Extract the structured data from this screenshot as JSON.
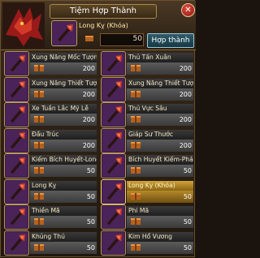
{
  "header": {
    "title": "Tiệm Hợp Thành",
    "close_symbol": "✕",
    "target_name": "Long Kỵ (Khóa)",
    "target_qty": "50",
    "craft_label": "Hợp thành",
    "target_icon": "purple-axe-icon"
  },
  "items": [
    {
      "name": "Xung Năng Mốc Tượng",
      "qty": "200"
    },
    {
      "name": "Thủ Tấn Xuân",
      "qty": "200"
    },
    {
      "name": "Xung Năng Thiết Tượng",
      "qty": "200"
    },
    {
      "name": "Xung Năng Thiết Tượng",
      "qty": "200"
    },
    {
      "name": "Xe Tuần Lắc Mỹ Lễ",
      "qty": "200"
    },
    {
      "name": "Thủ Vực Sâu",
      "qty": "200"
    },
    {
      "name": "Đầu Trúc",
      "qty": "200"
    },
    {
      "name": "Giáp Sư Thước",
      "qty": "200"
    },
    {
      "name": "Kiếm Bích Huyết-Long",
      "qty": "50"
    },
    {
      "name": "Bích Huyết Kiếm-Phá Vu",
      "qty": "50"
    },
    {
      "name": "Long Kỵ",
      "qty": "50"
    },
    {
      "name": "Long Kỵ (Khóa)",
      "qty": "50",
      "selected": true
    },
    {
      "name": "Thiền Mã",
      "qty": "50"
    },
    {
      "name": "Phi Mã",
      "qty": "50"
    },
    {
      "name": "Khủng Thú",
      "qty": "50"
    },
    {
      "name": "Kim Hổ Vương",
      "qty": "50"
    }
  ],
  "colors": {
    "accent_gold": "#d0a236",
    "craft_button": "#2f5b6a",
    "slot_purple": "#3b1c49"
  }
}
